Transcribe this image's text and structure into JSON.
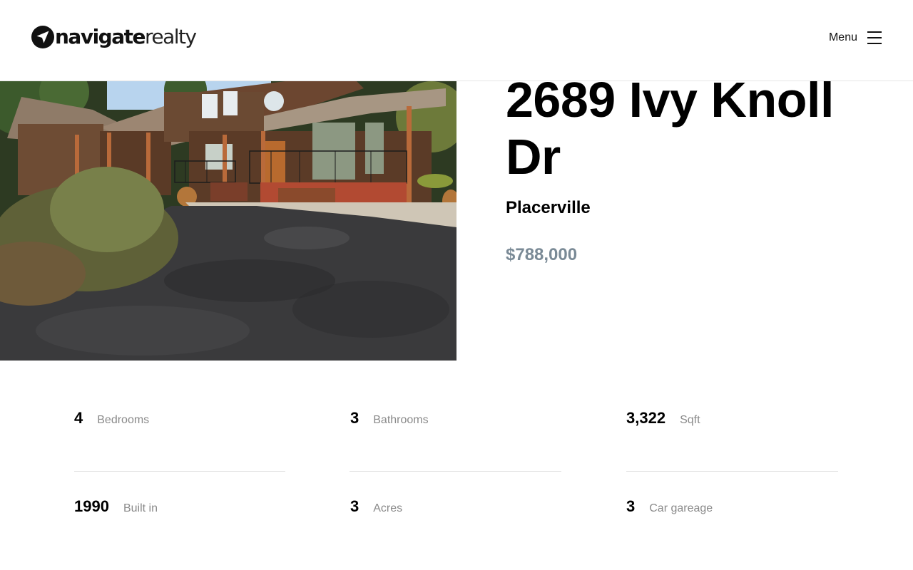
{
  "brand": {
    "name_bold": "navigate",
    "name_light": "realty",
    "icon": "paper-plane-icon"
  },
  "header": {
    "menu_label": "Menu",
    "menu_icon": "hamburger-icon"
  },
  "listing": {
    "address": "2689 Ivy Knoll Dr",
    "city": "Placerville",
    "price": "$788,000",
    "stats": [
      {
        "value": "4",
        "label": "Bedrooms"
      },
      {
        "value": "3",
        "label": "Bathrooms"
      },
      {
        "value": "3,322",
        "label": "Sqft"
      },
      {
        "value": "1990",
        "label": "Built in"
      },
      {
        "value": "3",
        "label": "Acres"
      },
      {
        "value": "3",
        "label": "Car gareage"
      }
    ]
  },
  "colors": {
    "price": "#7a8a96",
    "stat_label": "#8a8a8a",
    "divider": "#e2e2e2"
  }
}
